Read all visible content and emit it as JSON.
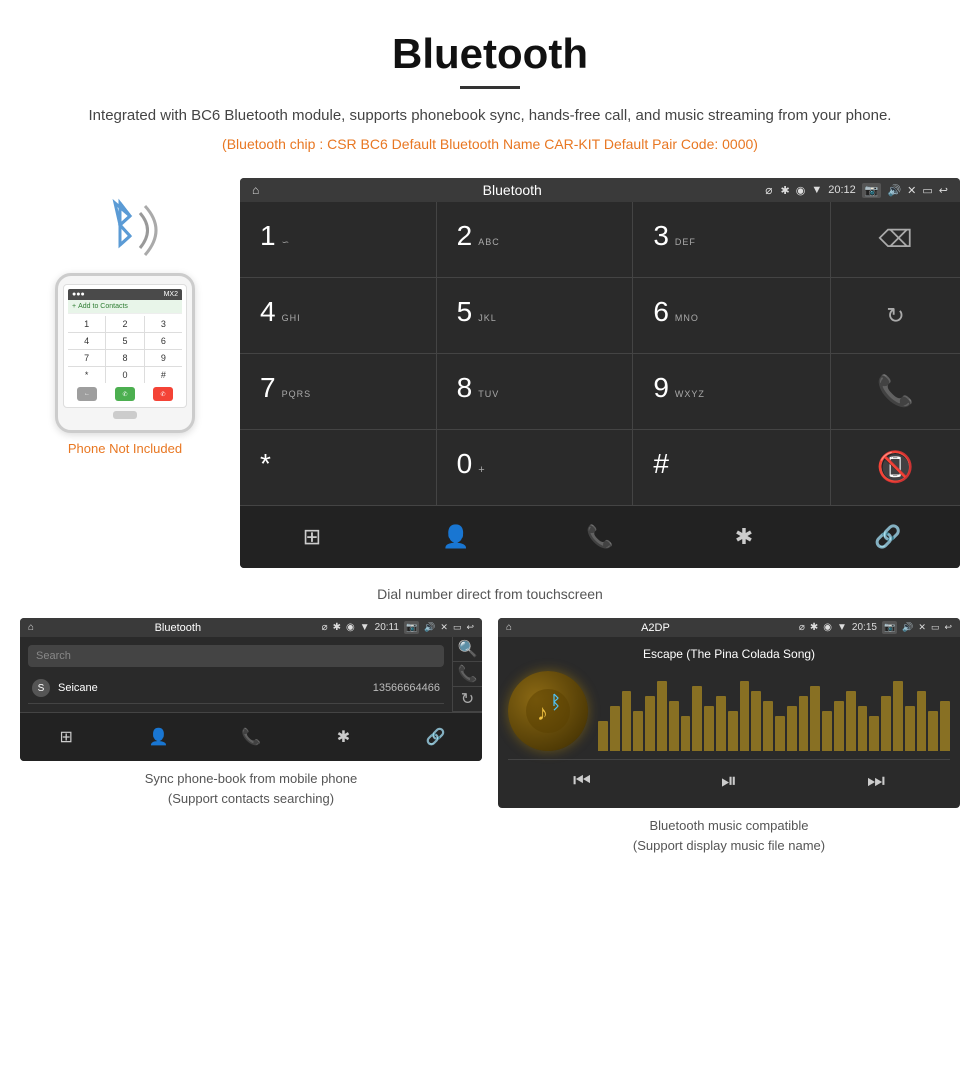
{
  "page": {
    "title": "Bluetooth",
    "divider": true,
    "description": "Integrated with BC6 Bluetooth module, supports phonebook sync, hands-free call, and music streaming from your phone.",
    "orange_info": "(Bluetooth chip : CSR BC6    Default Bluetooth Name CAR-KIT    Default Pair Code: 0000)"
  },
  "main_screen": {
    "status_bar": {
      "home_icon": "⌂",
      "title": "Bluetooth",
      "usb_icon": "⌀",
      "bt_icon": "✱",
      "location_icon": "◉",
      "signal_icon": "▼",
      "time": "20:12",
      "camera_icon": "📷",
      "volume_icon": "🔊",
      "close_icon": "✕",
      "window_icon": "▭",
      "back_icon": "↩"
    },
    "dialpad": {
      "rows": [
        [
          {
            "number": "1",
            "sub": "∽"
          },
          {
            "number": "2",
            "sub": "ABC"
          },
          {
            "number": "3",
            "sub": "DEF"
          }
        ],
        [
          {
            "number": "4",
            "sub": "GHI"
          },
          {
            "number": "5",
            "sub": "JKL"
          },
          {
            "number": "6",
            "sub": "MNO"
          }
        ],
        [
          {
            "number": "7",
            "sub": "PQRS"
          },
          {
            "number": "8",
            "sub": "TUV"
          },
          {
            "number": "9",
            "sub": "WXYZ"
          }
        ],
        [
          {
            "number": "*",
            "sub": ""
          },
          {
            "number": "0",
            "sub": "+"
          },
          {
            "number": "#",
            "sub": ""
          }
        ]
      ],
      "right_panel": {
        "backspace": "⌫",
        "refresh": "↻",
        "call_green": "📞",
        "call_red": "📵"
      }
    },
    "bottom_nav": {
      "items": [
        "⊞",
        "👤",
        "📞",
        "✱",
        "🔗"
      ]
    }
  },
  "main_caption": "Dial number direct from touchscreen",
  "phone_panel": {
    "not_included": "Phone Not Included",
    "keypad_keys": [
      "1",
      "2",
      "3",
      "4",
      "5",
      "6",
      "7",
      "8",
      "9",
      "*",
      "0",
      "#"
    ]
  },
  "bottom_left": {
    "status_bar": {
      "home_icon": "⌂",
      "title": "Bluetooth",
      "usb_icon": "⌀",
      "bt_icon": "✱",
      "location_icon": "◉",
      "signal_icon": "▼",
      "time": "20:11",
      "camera_icon": "📷",
      "volume_icon": "🔊",
      "close_icon": "✕",
      "window_icon": "▭",
      "back_icon": "↩"
    },
    "search_placeholder": "Search",
    "contact": {
      "letter": "S",
      "name": "Seicane",
      "number": "13566664466"
    },
    "right_icons": [
      "🔍",
      "📞",
      "↻"
    ],
    "bottom_nav": {
      "items": [
        "⊞",
        "👤",
        "📞",
        "✱",
        "🔗"
      ]
    },
    "caption_line1": "Sync phone-book from mobile phone",
    "caption_line2": "(Support contacts searching)"
  },
  "bottom_right": {
    "status_bar": {
      "home_icon": "⌂",
      "title": "A2DP",
      "usb_icon": "⌀",
      "bt_icon": "✱",
      "location_icon": "◉",
      "signal_icon": "▼",
      "time": "20:15",
      "camera_icon": "📷",
      "volume_icon": "🔊",
      "close_icon": "✕",
      "window_icon": "▭",
      "back_icon": "↩"
    },
    "song_title": "Escape (The Pina Colada Song)",
    "music_icon": "♪",
    "controls": {
      "prev": "⏮",
      "play_pause": "⏯",
      "next": "⏭"
    },
    "waveform_heights": [
      30,
      45,
      60,
      40,
      55,
      70,
      50,
      35,
      65,
      45,
      55,
      40,
      70,
      60,
      50,
      35,
      45,
      55,
      65,
      40,
      50,
      60,
      45,
      35,
      55,
      70,
      45,
      60,
      40,
      50
    ],
    "caption_line1": "Bluetooth music compatible",
    "caption_line2": "(Support display music file name)"
  }
}
